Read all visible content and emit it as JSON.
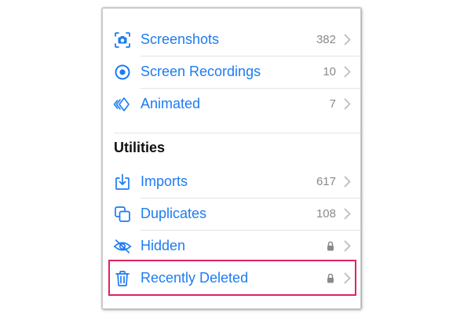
{
  "colors": {
    "accent": "#1d7cf2",
    "secondary_text": "#8a8a8e",
    "highlight": "#e0245e"
  },
  "media_types": {
    "items": [
      {
        "label": "Screenshots",
        "count": "382",
        "icon": "screenshot-icon"
      },
      {
        "label": "Screen Recordings",
        "count": "10",
        "icon": "screen-recording-icon"
      },
      {
        "label": "Animated",
        "count": "7",
        "icon": "animated-icon"
      }
    ]
  },
  "utilities": {
    "title": "Utilities",
    "items": [
      {
        "label": "Imports",
        "count": "617",
        "icon": "import-icon"
      },
      {
        "label": "Duplicates",
        "count": "108",
        "icon": "duplicates-icon"
      },
      {
        "label": "Hidden",
        "locked": true,
        "icon": "eye-slash-icon"
      },
      {
        "label": "Recently Deleted",
        "locked": true,
        "icon": "trash-icon",
        "highlighted": true
      }
    ]
  }
}
